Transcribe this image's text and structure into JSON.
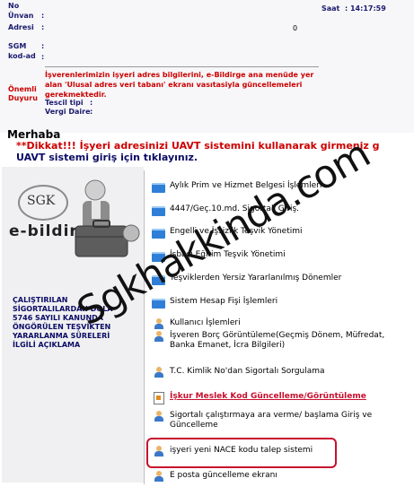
{
  "header": {
    "no_label": "No",
    "unvan_label": "Ünvan",
    "adresi_label": "Adresi",
    "sgm_label": "SGM",
    "kod_label": "kod-ad",
    "colon": ":",
    "adres_value": "0",
    "saat_label": "Saat",
    "saat_value": ": 14:17:59"
  },
  "notice": {
    "label_onemli": "Önemli",
    "label_duyuru": "Duyuru",
    "text": "İşverenlerimizin işyeri adres bilgilerini, e-Bildirge ana menüde yer alan 'Ulusal adres veri tabanı' ekranı vasıtasiyla güncellemeleri gerekmektedir.",
    "tescil_label": "Tescil tipi",
    "vergi_label": "Vergi Daire"
  },
  "greeting": "Merhaba",
  "warning": "**Dikkat!!! İşyeri adresinizi UAVT sistemini kullanarak girmeniz g",
  "uavt_link": "UAVT sistemi giriş için tıklayınız.",
  "logo": {
    "sgk": "SGK",
    "ebildirge": "e-bildirge"
  },
  "left_notice": [
    "ÇALIŞTIRILAN",
    "SİGORTALILARDAN DOLA",
    "5746 SAYILI KANUNDA",
    "ÖNGÖRÜLEN TEŞVİKTEN",
    "YARARLANMA SÜRELERİ",
    "İLGİLİ AÇIKLAMA"
  ],
  "menu": {
    "items": [
      {
        "label": "Aylık Prim ve Hizmet Belgesi İşlemleri",
        "icon": "folder-icon"
      },
      {
        "label": "4447/Geç.10.md. Sigortalı Giriş.",
        "icon": "folder-icon"
      },
      {
        "label": "Engelli ve İşsizlik Teşvik Yönetimi",
        "icon": "folder-icon"
      },
      {
        "label": "İşbaşı Eğitim Teşvik Yönetimi",
        "icon": "folder-icon"
      },
      {
        "label": "Teşviklerden Yersiz Yararlanılmış Dönemler",
        "icon": "folder-icon"
      },
      {
        "label": "Sistem Hesap Fişi İşlemleri",
        "icon": "folder-icon"
      },
      {
        "label": "Kullanıcı İşlemleri",
        "icon": "user-icon"
      },
      {
        "label": "İşveren Borç Görüntüleme(Geçmiş Dönem, Müfredat, Banka Emanet, İcra Bilgileri)",
        "icon": "user-icon"
      },
      {
        "label": "T.C. Kimlik No'dan Sigortalı Sorgulama",
        "icon": "user-icon"
      },
      {
        "label": "İşkur Meslek Kod Güncelleme/Görüntüleme",
        "icon": "document-icon"
      },
      {
        "label": "Sigortalı çalıştırmaya ara verme/ başlama Giriş ve Güncelleme",
        "icon": "user-icon"
      },
      {
        "label": "işyeri yeni NACE kodu talep sistemi",
        "icon": "user-icon"
      },
      {
        "label": "E posta güncelleme ekranı",
        "icon": "user-icon"
      }
    ]
  },
  "watermark": "Sgkhakkinda.com",
  "colors": {
    "navy": "#1a1a6e",
    "red": "#cc0000",
    "link_blue": "#0b0b66",
    "highlight": "#c8102e"
  }
}
